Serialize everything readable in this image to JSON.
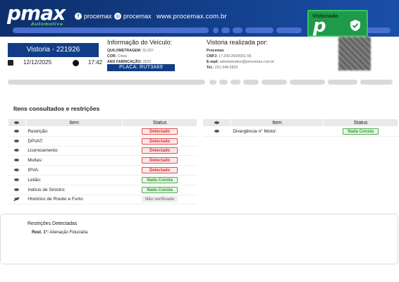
{
  "header": {
    "logo_main": "pmax",
    "logo_sub": "Automotive",
    "facebook": "procemax",
    "instagram": "procemax",
    "website": "www.procemax.com.br",
    "badge_text": "Vistoriado",
    "badge_letter": "p"
  },
  "vehicle": {
    "vistoria_label": "Vistoria - 221926",
    "date": "12/12/2025",
    "time": "17:42",
    "info_title": "Informação do Veículo:",
    "quilometragem_label": "QUILOMETRAGEM:",
    "quilometragem_value": "33.297",
    "cor_label": "COR:",
    "cor_value": "Cinza",
    "ano_label": "ANO FABRICAÇÃO:",
    "ano_value": "2022",
    "placa": "PLACA: RUT3A69"
  },
  "company": {
    "title": "Vistoria realizada por:",
    "name": "Procemax",
    "cnpj_label": "CNPJ:",
    "cnpj_value": "17.209.266/0001-56",
    "email_label": "E-mail:",
    "email_value": "administrativo@procemax.com.br",
    "tel_label": "Tel.:",
    "tel_value": "(31) 348-5826"
  },
  "section_title": "Itens consultados e restrições",
  "table_left": {
    "col_item": "Item",
    "col_status": "Status",
    "rows": [
      {
        "item": "Restrição:",
        "status": "Detectado",
        "kind": "red",
        "icon": "eye-icon"
      },
      {
        "item": "DPVAT:",
        "status": "Detectado",
        "kind": "red",
        "icon": "eye-icon"
      },
      {
        "item": "Licenciamento:",
        "status": "Detectado",
        "kind": "red",
        "icon": "eye-icon"
      },
      {
        "item": "Multas:",
        "status": "Detectado",
        "kind": "red",
        "icon": "eye-icon"
      },
      {
        "item": "IPVA:",
        "status": "Detectado",
        "kind": "red",
        "icon": "eye-icon"
      },
      {
        "item": "Leilão:",
        "status": "Nada Consta",
        "kind": "green",
        "icon": "eye-icon"
      },
      {
        "item": "Indício de Sinistro:",
        "status": "Nada Consta",
        "kind": "green",
        "icon": "eye-icon"
      },
      {
        "item": "Histórico de Roubo e Furto:",
        "status": "Não verificado",
        "kind": "gray",
        "icon": "eye-slash-icon"
      }
    ]
  },
  "table_right": {
    "col_item": "Item",
    "col_status": "Status",
    "rows": [
      {
        "item": "Divergência n° Motor:",
        "status": "Nada Consta",
        "kind": "green",
        "icon": "eye-icon"
      }
    ]
  },
  "restrictions": {
    "title": "Restrições Detectadas",
    "label": "Rest. 1°:",
    "value": "Alienação Fiduciária"
  },
  "colors": {
    "header_blue": "#123d86",
    "brand_green": "#1f9a4a",
    "detected_red": "#d32f2f",
    "ok_green": "#2e9a2e"
  }
}
